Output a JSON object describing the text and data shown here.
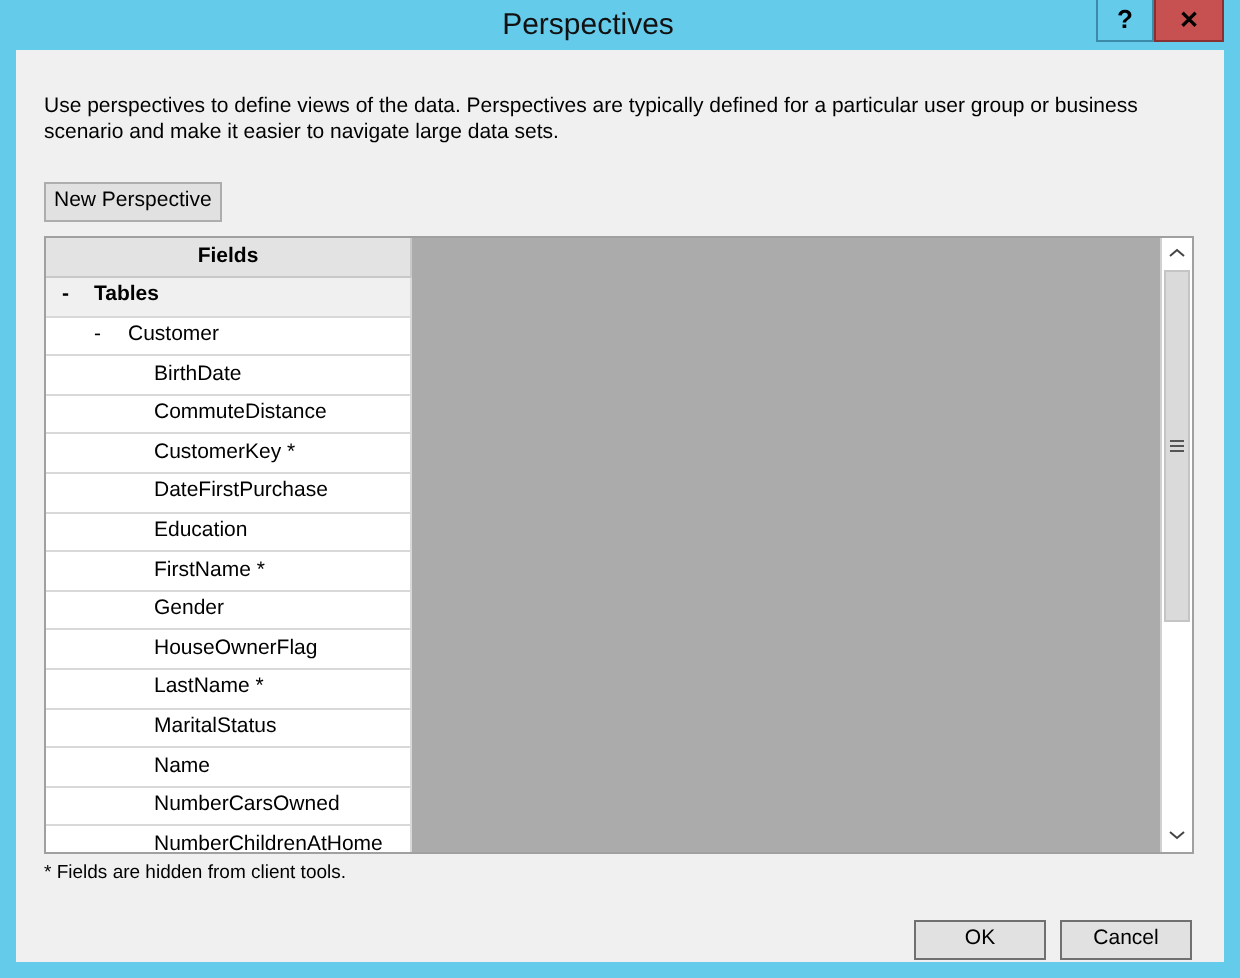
{
  "window": {
    "title": "Perspectives",
    "help_button": "?",
    "close_button": "✕"
  },
  "description": "Use perspectives to define views of the data. Perspectives are typically defined for a particular user group or business scenario and make it easier to navigate large data sets.",
  "new_button": "New Perspective",
  "grid": {
    "column": "Fields",
    "tree": [
      {
        "label": "Tables",
        "toggle": "-",
        "children": [
          {
            "label": "Customer",
            "toggle": "-",
            "children": [
              {
                "label": "BirthDate"
              },
              {
                "label": "CommuteDistance"
              },
              {
                "label": "CustomerKey *"
              },
              {
                "label": "DateFirstPurchase"
              },
              {
                "label": "Education"
              },
              {
                "label": "FirstName *"
              },
              {
                "label": "Gender"
              },
              {
                "label": "HouseOwnerFlag"
              },
              {
                "label": "LastName *"
              },
              {
                "label": "MaritalStatus"
              },
              {
                "label": "Name"
              },
              {
                "label": "NumberCarsOwned"
              },
              {
                "label": "NumberChildrenAtHome"
              }
            ]
          }
        ]
      }
    ]
  },
  "footnote": "* Fields are hidden from client tools.",
  "buttons": [
    "OK",
    "Cancel"
  ]
}
